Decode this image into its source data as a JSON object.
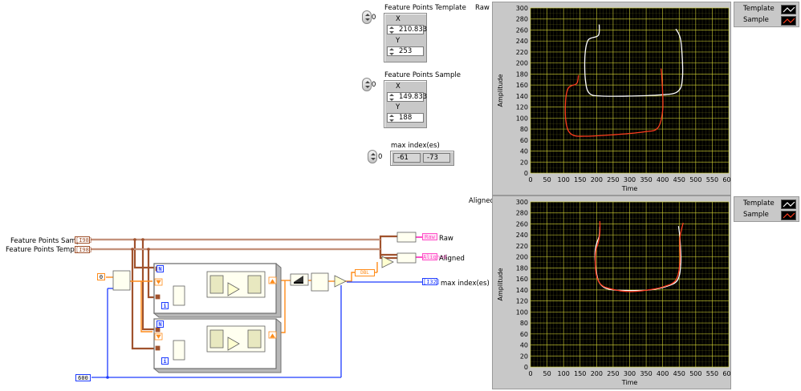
{
  "front_panel": {
    "fp_template": {
      "label": "Feature Points Template",
      "index": "0",
      "x_label": "X",
      "x_value": "210.833",
      "y_label": "Y",
      "y_value": "253"
    },
    "fp_sample": {
      "label": "Feature Points Sample",
      "index": "0",
      "x_label": "X",
      "x_value": "149.833",
      "y_label": "Y",
      "y_value": "188"
    },
    "max_index": {
      "label": "max index(es)",
      "index": "0",
      "values": [
        "-61",
        "-73"
      ]
    }
  },
  "graphs": {
    "raw": {
      "title": "Raw"
    },
    "aligned": {
      "title": "Aligned"
    },
    "legend": [
      {
        "name": "Template",
        "color": "#ffffff"
      },
      {
        "name": "Sample",
        "color": "#ff3c1e"
      }
    ],
    "plot_bg": "#000000",
    "grid_color": "#c8c832",
    "x_axis_label": "Time",
    "y_axis_label": "Amplitude",
    "x_ticks": [
      "0",
      "50",
      "100",
      "150",
      "200",
      "250",
      "300",
      "350",
      "400",
      "450",
      "500",
      "550",
      "600"
    ],
    "y_ticks": [
      "300",
      "280",
      "260",
      "240",
      "220",
      "200",
      "180",
      "160",
      "140",
      "120",
      "100",
      "80",
      "60",
      "40",
      "20",
      "0"
    ]
  },
  "diagram": {
    "ctrl_sample_label": "Feature Points Sample",
    "ctrl_template_label": "Feature Points Template",
    "ctrl_type": "[I98]",
    "const_zero": "0",
    "const_600": "600",
    "loop_n": "N",
    "loop_i": "i",
    "ind_raw": "Raw",
    "ind_aligned": "Aligned",
    "ind_max": "max index(es)",
    "ind_max_type": "[I32]",
    "dbl_label": "DBL",
    "wire_orange": "#ff8c1a",
    "wire_brown": "#a0522d",
    "wire_blue": "#1e3cff",
    "wire_pink": "#ff50c8"
  }
}
